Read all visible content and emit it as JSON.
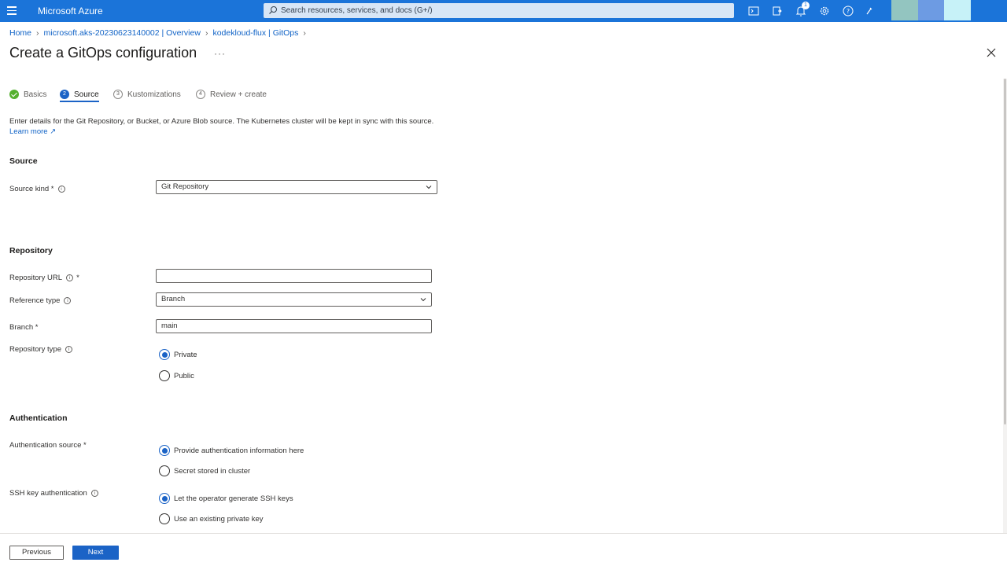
{
  "topbar": {
    "brand": "Microsoft Azure",
    "search_placeholder": "Search resources, services, and docs (G+/)",
    "notification_count": "1",
    "bar_color": "#1b74d9"
  },
  "breadcrumb": {
    "items": [
      "Home",
      "microsoft.aks-20230623140002 | Overview",
      "kodekloud-flux | GitOps"
    ]
  },
  "page": {
    "title": "Create a GitOps configuration",
    "more": "···"
  },
  "tabs": [
    {
      "label": "Basics",
      "num": "",
      "state": "done"
    },
    {
      "label": "Source",
      "num": "2",
      "state": "current"
    },
    {
      "label": "Kustomizations",
      "num": "3",
      "state": "pending"
    },
    {
      "label": "Review + create",
      "num": "4",
      "state": "pending"
    }
  ],
  "description": {
    "text": "Enter details for the Git Repository, or Bucket, or Azure Blob source. The Kubernetes cluster will be kept in sync with this source.",
    "link": "Learn more"
  },
  "source_section": {
    "heading": "Source",
    "kind_label": "Source kind *",
    "kind_value": "Git Repository"
  },
  "repository_section": {
    "heading": "Repository",
    "url_label": "Repository URL",
    "url_required": "*",
    "url_value": "",
    "ref_type_label": "Reference type",
    "ref_type_value": "Branch",
    "branch_label": "Branch *",
    "branch_value": "main",
    "repo_type_label": "Repository type",
    "repo_type_options": [
      "Private",
      "Public"
    ]
  },
  "auth_section": {
    "heading": "Authentication",
    "source_label": "Authentication source *",
    "source_options": [
      "Provide authentication information here",
      "Secret stored in cluster"
    ],
    "ssh_label": "SSH key authentication",
    "ssh_options": [
      "Let the operator generate SSH keys",
      "Use an existing private key"
    ]
  },
  "footer": {
    "previous": "Previous",
    "next": "Next"
  }
}
